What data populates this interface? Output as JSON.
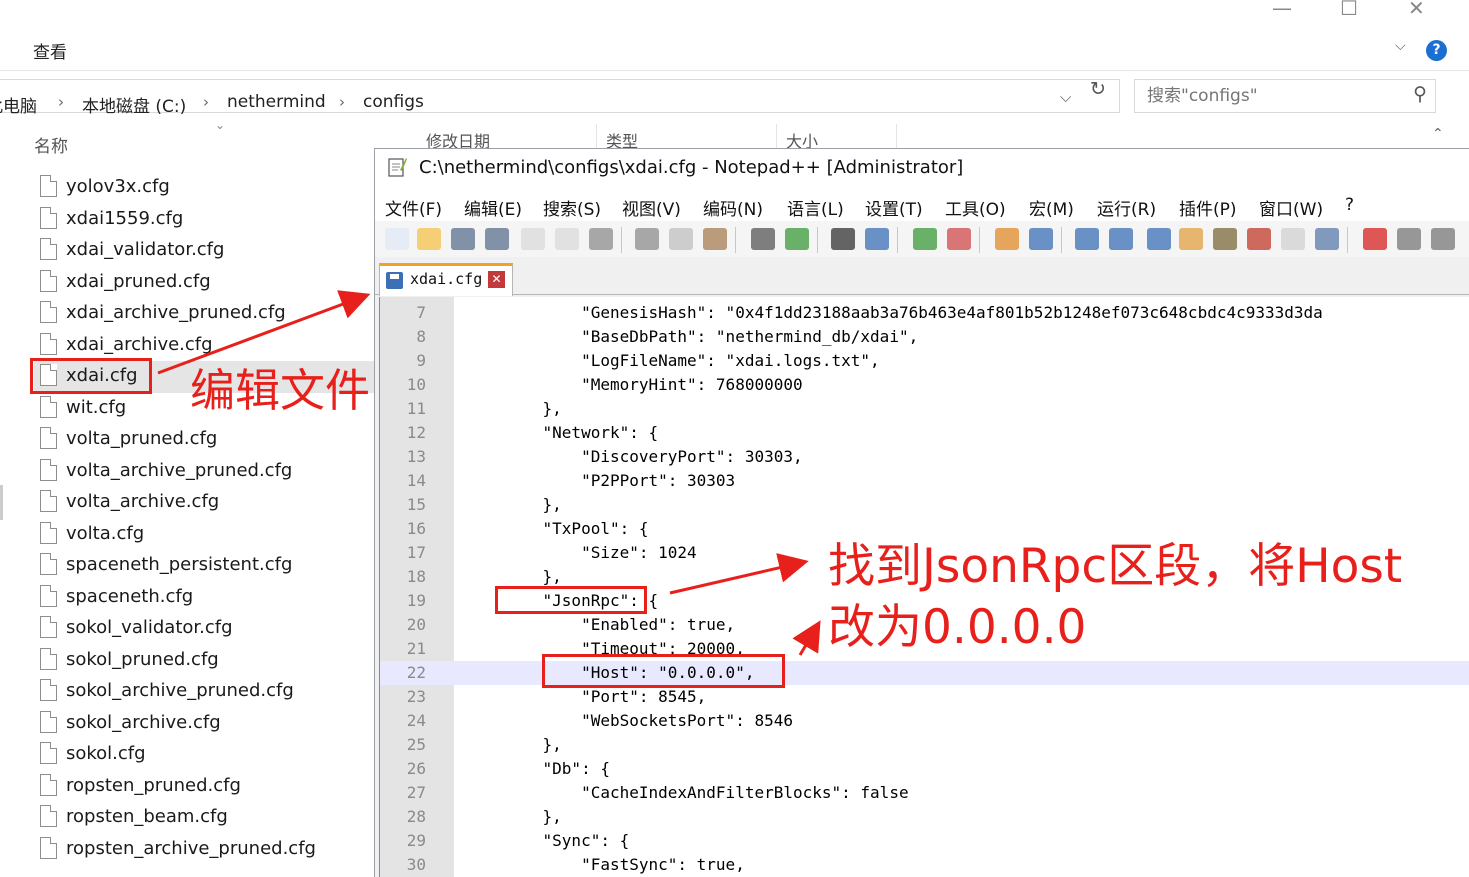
{
  "explorer": {
    "ribbon_tab": "查看",
    "breadcrumb": [
      "此电脑",
      "本地磁盘 (C:)",
      "nethermind",
      "configs"
    ],
    "search_placeholder": "搜索\"configs\"",
    "column_name": "名称",
    "column_date": "修改日期",
    "column_type": "类型",
    "column_size": "大小",
    "files": [
      "yolov3x.cfg",
      "xdai1559.cfg",
      "xdai_validator.cfg",
      "xdai_pruned.cfg",
      "xdai_archive_pruned.cfg",
      "xdai_archive.cfg",
      "xdai.cfg",
      "wit.cfg",
      "volta_pruned.cfg",
      "volta_archive_pruned.cfg",
      "volta_archive.cfg",
      "volta.cfg",
      "spaceneth_persistent.cfg",
      "spaceneth.cfg",
      "sokol_validator.cfg",
      "sokol_pruned.cfg",
      "sokol_archive_pruned.cfg",
      "sokol_archive.cfg",
      "sokol.cfg",
      "ropsten_pruned.cfg",
      "ropsten_beam.cfg",
      "ropsten_archive_pruned.cfg"
    ],
    "selected_file": "xdai.cfg"
  },
  "notepad": {
    "title": "C:\\nethermind\\configs\\xdai.cfg - Notepad++ [Administrator]",
    "menu": [
      "文件(F)",
      "编辑(E)",
      "搜索(S)",
      "视图(V)",
      "编码(N)",
      "语言(L)",
      "设置(T)",
      "工具(O)",
      "宏(M)",
      "运行(R)",
      "插件(P)",
      "窗口(W)",
      "?"
    ],
    "tab_label": "xdai.cfg",
    "current_line": 22,
    "lines": [
      {
        "n": "7",
        "text": "        \"GenesisHash\": \"0x4f1dd23188aab3a76b463e4af801b52b1248ef073c648cbdc4c9333d3da"
      },
      {
        "n": "8",
        "text": "        \"BaseDbPath\": \"nethermind_db/xdai\","
      },
      {
        "n": "9",
        "text": "        \"LogFileName\": \"xdai.logs.txt\","
      },
      {
        "n": "10",
        "text": "        \"MemoryHint\": 768000000"
      },
      {
        "n": "11",
        "text": "    },"
      },
      {
        "n": "12",
        "text": "    \"Network\": {"
      },
      {
        "n": "13",
        "text": "        \"DiscoveryPort\": 30303,"
      },
      {
        "n": "14",
        "text": "        \"P2PPort\": 30303"
      },
      {
        "n": "15",
        "text": "    },"
      },
      {
        "n": "16",
        "text": "    \"TxPool\": {"
      },
      {
        "n": "17",
        "text": "        \"Size\": 1024"
      },
      {
        "n": "18",
        "text": "    },"
      },
      {
        "n": "19",
        "text": "    \"JsonRpc\": {"
      },
      {
        "n": "20",
        "text": "        \"Enabled\": true,"
      },
      {
        "n": "21",
        "text": "        \"Timeout\": 20000,"
      },
      {
        "n": "22",
        "text": "        \"Host\": \"0.0.0.0\","
      },
      {
        "n": "23",
        "text": "        \"Port\": 8545,"
      },
      {
        "n": "24",
        "text": "        \"WebSocketsPort\": 8546"
      },
      {
        "n": "25",
        "text": "    },"
      },
      {
        "n": "26",
        "text": "    \"Db\": {"
      },
      {
        "n": "27",
        "text": "        \"CacheIndexAndFilterBlocks\": false"
      },
      {
        "n": "28",
        "text": "    },"
      },
      {
        "n": "29",
        "text": "    \"Sync\": {"
      },
      {
        "n": "30",
        "text": "        \"FastSync\": true,"
      }
    ]
  },
  "annotations": {
    "edit_file": "编辑文件",
    "instruction_line1": "找到JsonRpc区段，将Host",
    "instruction_line2": "改为0.0.0.0",
    "color": "#e8201b"
  }
}
